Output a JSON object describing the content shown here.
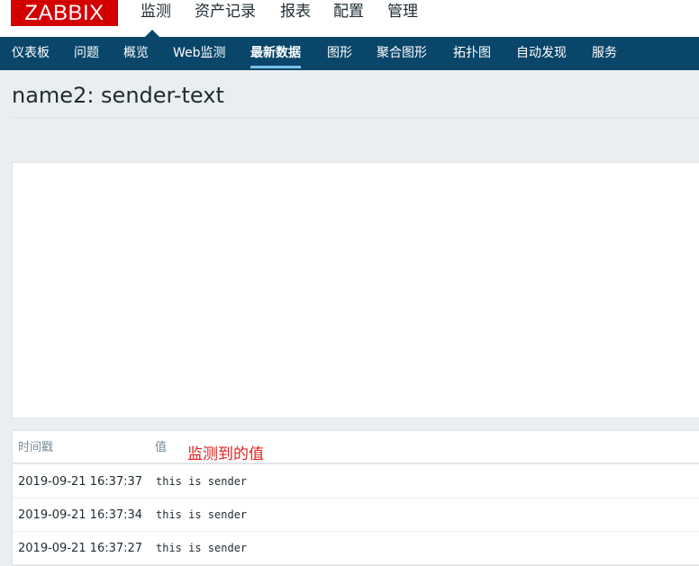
{
  "logo": "ZABBIX",
  "main_menu": [
    {
      "label": "监测"
    },
    {
      "label": "资产记录"
    },
    {
      "label": "报表"
    },
    {
      "label": "配置"
    },
    {
      "label": "管理"
    }
  ],
  "sub_menu": [
    {
      "label": "仪表板"
    },
    {
      "label": "问题"
    },
    {
      "label": "概览"
    },
    {
      "label": "Web监测"
    },
    {
      "label": "最新数据"
    },
    {
      "label": "图形"
    },
    {
      "label": "聚合图形"
    },
    {
      "label": "拓扑图"
    },
    {
      "label": "自动发现"
    },
    {
      "label": "服务"
    }
  ],
  "active_sub": "最新数据",
  "page_title": "name2: sender-text",
  "table": {
    "headers": {
      "timestamp": "时间戳",
      "value": "值"
    },
    "annotation": "监测到的值",
    "rows": [
      {
        "timestamp": "2019-09-21 16:37:37",
        "value": "this is sender"
      },
      {
        "timestamp": "2019-09-21 16:37:34",
        "value": "this is sender"
      },
      {
        "timestamp": "2019-09-21 16:37:27",
        "value": "this is sender"
      }
    ]
  },
  "colors": {
    "brand": "#d40000",
    "nav_bg": "#0a466a",
    "active_underline": "#7ac0e4",
    "annotation": "#e02020"
  }
}
